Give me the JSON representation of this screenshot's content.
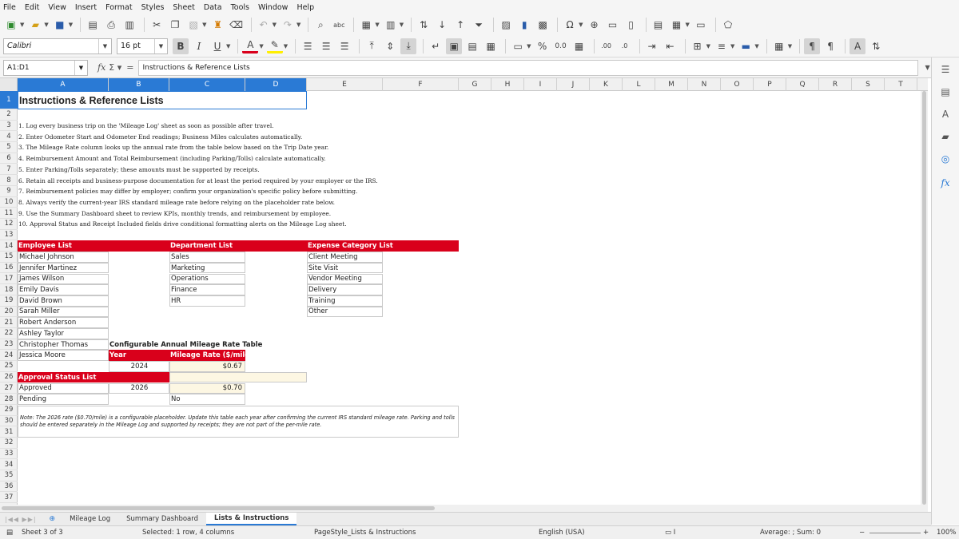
{
  "menu": [
    "File",
    "Edit",
    "View",
    "Insert",
    "Format",
    "Styles",
    "Sheet",
    "Data",
    "Tools",
    "Window",
    "Help"
  ],
  "toolbar": {
    "font_name": "Calibri",
    "font_size": "16 pt",
    "icons": [
      "new-icon",
      "open-icon",
      "save-icon",
      "export-pdf-icon",
      "print-icon",
      "print-preview-icon",
      "cut-icon",
      "copy-icon",
      "paste-icon",
      "clone-format-icon",
      "undo-icon",
      "redo-icon",
      "find-replace-icon",
      "spelling-icon",
      "row-icon",
      "column-icon",
      "sort-icon",
      "sort-ascending-icon",
      "sort-descending-icon",
      "autofilter-icon",
      "image-icon",
      "chart-icon",
      "pivot-table-icon",
      "special-character-icon",
      "hyperlink-icon",
      "comment-icon",
      "header-footer-icon",
      "define-print-area-icon",
      "freeze-icon",
      "split-window-icon",
      "show-draw-functions-icon"
    ]
  },
  "formula_bar": {
    "name_box": "A1:D1",
    "content": "Instructions & Reference Lists"
  },
  "columns": [
    "A",
    "B",
    "C",
    "D",
    "E",
    "F",
    "G",
    "H",
    "I",
    "J",
    "K",
    "L",
    "M",
    "N",
    "O",
    "P",
    "Q",
    "R",
    "S",
    "T"
  ],
  "rows": [
    "1",
    "2",
    "3",
    "4",
    "5",
    "6",
    "7",
    "8",
    "9",
    "10",
    "11",
    "12",
    "13",
    "14",
    "15",
    "16",
    "17",
    "18",
    "19",
    "20",
    "21",
    "22",
    "23",
    "24",
    "25",
    "26",
    "27",
    "28",
    "29",
    "30",
    "31",
    "32",
    "33",
    "34",
    "35",
    "36",
    "37"
  ],
  "sheet": {
    "title": "Instructions & Reference Lists",
    "instructions": [
      "1. Log every business trip on the 'Mileage Log' sheet as soon as possible after travel.",
      "2. Enter Odometer Start and Odometer End readings; Business Miles calculates automatically.",
      "3. The Mileage Rate column looks up the annual rate from the table below based on the Trip Date year.",
      "4. Reimbursement Amount and Total Reimbursement (including Parking/Tolls) calculate automatically.",
      "5. Enter Parking/Tolls separately; these amounts must be supported by receipts.",
      "6. Retain all receipts and business-purpose documentation for at least the period required by your employer or the IRS.",
      "7. Reimbursement policies may differ by employer; confirm your organization's specific policy before submitting.",
      "8. Always verify the current-year IRS standard mileage rate before relying on the placeholder rate below.",
      "9. Use the Summary Dashboard sheet to review KPIs, monthly trends, and reimbursement by employee.",
      "10. Approval Status and Receipt Included fields drive conditional formatting alerts on the Mileage Log sheet."
    ],
    "employee_header": "Employee List",
    "employees": [
      "Michael Johnson",
      "Jennifer Martinez",
      "James Wilson",
      "Emily Davis",
      "David Brown",
      "Sarah Miller",
      "Robert Anderson",
      "Ashley Taylor",
      "Christopher Thomas",
      "Jessica Moore"
    ],
    "department_header": "Department List",
    "departments": [
      "Sales",
      "Marketing",
      "Operations",
      "Finance",
      "HR"
    ],
    "category_header": "Expense Category List",
    "categories": [
      "Client Meeting",
      "Site Visit",
      "Vendor Meeting",
      "Delivery",
      "Training",
      "Other"
    ],
    "rate_table_title": "Configurable Annual Mileage Rate Table",
    "rate_col_year": "Year",
    "rate_col_rate": "Mileage Rate ($/mile)",
    "rate_rows": [
      {
        "year": "2024",
        "rate": "$0.67"
      },
      {
        "year": "2026",
        "rate": "$0.70"
      }
    ],
    "approval_header": "Approval Status List",
    "approval": [
      "Approved",
      "Pending"
    ],
    "stray_no": "No",
    "note": "Note: The 2026 rate ($0.70/mile) is a configurable placeholder. Update this table each year after confirming the current IRS standard mileage rate. Parking and tolls should be entered separately in the Mileage Log and supported by receipts; they are not part of the per-mile rate."
  },
  "tabs": [
    "Mileage Log",
    "Summary Dashboard",
    "Lists & Instructions"
  ],
  "active_tab": "Lists & Instructions",
  "status_bar": {
    "sheet": "Sheet 3 of 3",
    "selection": "Selected: 1 row, 4 columns",
    "page_style": "PageStyle_Lists & Instructions",
    "language": "English (USA)",
    "summary": "Average: ; Sum: 0",
    "zoom": "100%"
  },
  "colors": {
    "header_red": "#d9001b",
    "selection_blue": "#2a7ad5",
    "rate_cell_fill": "#fdf7e3"
  }
}
